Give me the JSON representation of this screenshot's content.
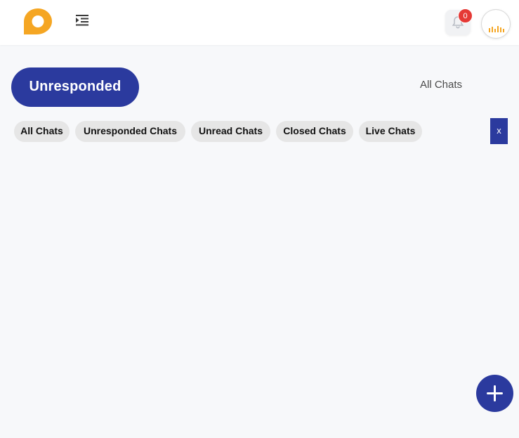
{
  "header": {
    "logo_icon": "chat-bubble-logo",
    "menu_icon": "indent-menu-icon",
    "notifications": {
      "icon": "bell-icon",
      "count": "0"
    },
    "avatar_icon": "user-avatar"
  },
  "view_tabs": {
    "active": "Unresponded",
    "other": "All Chats"
  },
  "filters": [
    {
      "label": "All Chats"
    },
    {
      "label": "Unresponded Chats"
    },
    {
      "label": "Unread Chats"
    },
    {
      "label": "Closed Chats"
    },
    {
      "label": "Live Chats"
    }
  ],
  "close_label": "x",
  "fab_icon": "plus-icon",
  "colors": {
    "primary": "#2b3a9e",
    "logo": "#f5a623",
    "badge": "#e53935",
    "chip_bg": "#e6e6e6",
    "background": "#f7f8fa"
  }
}
